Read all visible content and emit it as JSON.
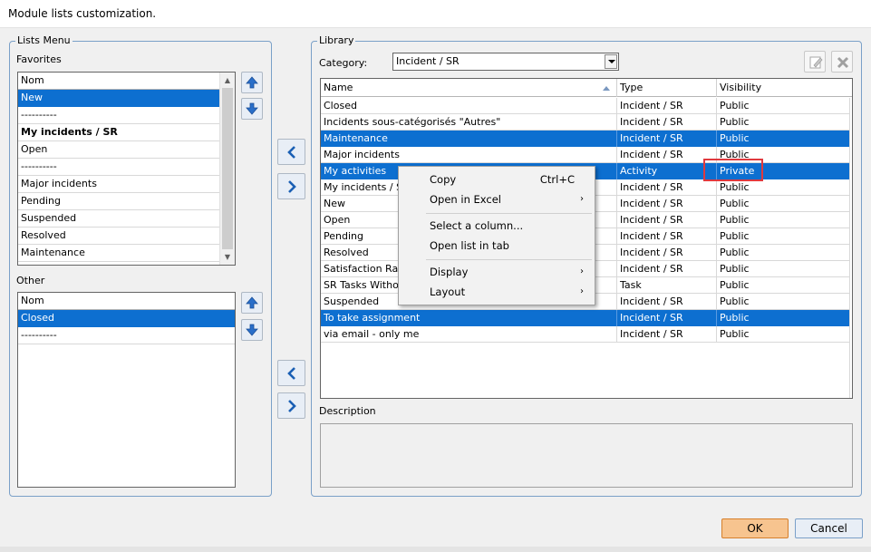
{
  "window": {
    "title": "Module lists customization."
  },
  "lists_menu": {
    "title": "Lists Menu",
    "favorites": {
      "label": "Favorites",
      "header": "Nom",
      "items": [
        {
          "label": "New",
          "selected": true,
          "bold": false
        },
        {
          "label": "----------",
          "selected": false,
          "bold": false
        },
        {
          "label": "My incidents / SR",
          "selected": false,
          "bold": true
        },
        {
          "label": "Open",
          "selected": false,
          "bold": false
        },
        {
          "label": "----------",
          "selected": false,
          "bold": false
        },
        {
          "label": "Major incidents",
          "selected": false,
          "bold": false
        },
        {
          "label": "Pending",
          "selected": false,
          "bold": false
        },
        {
          "label": "Suspended",
          "selected": false,
          "bold": false
        },
        {
          "label": "Resolved",
          "selected": false,
          "bold": false
        },
        {
          "label": "Maintenance",
          "selected": false,
          "bold": false
        }
      ]
    },
    "other": {
      "label": "Other",
      "header": "Nom",
      "items": [
        {
          "label": "Closed",
          "selected": true,
          "bold": false
        },
        {
          "label": "----------",
          "selected": false,
          "bold": false
        }
      ]
    }
  },
  "library": {
    "title": "Library",
    "category_label": "Category:",
    "category_value": "Incident / SR",
    "columns": {
      "name": "Name",
      "type": "Type",
      "visibility": "Visibility"
    },
    "rows": [
      {
        "name": "Closed",
        "type": "Incident / SR",
        "visibility": "Public",
        "selected": false
      },
      {
        "name": "Incidents sous-catégorisés \"Autres\"",
        "type": "Incident / SR",
        "visibility": "Public",
        "selected": false
      },
      {
        "name": "Maintenance",
        "type": "Incident / SR",
        "visibility": "Public",
        "selected": true
      },
      {
        "name": "Major incidents",
        "type": "Incident / SR",
        "visibility": "Public",
        "selected": false
      },
      {
        "name": "My activities",
        "type": "Activity",
        "visibility": "Private",
        "selected": true
      },
      {
        "name": "My incidents / SR",
        "type": "Incident / SR",
        "visibility": "Public",
        "selected": false
      },
      {
        "name": "New",
        "type": "Incident / SR",
        "visibility": "Public",
        "selected": false
      },
      {
        "name": "Open",
        "type": "Incident / SR",
        "visibility": "Public",
        "selected": false
      },
      {
        "name": "Pending",
        "type": "Incident / SR",
        "visibility": "Public",
        "selected": false
      },
      {
        "name": "Resolved",
        "type": "Incident / SR",
        "visibility": "Public",
        "selected": false
      },
      {
        "name": "Satisfaction Rating",
        "type": "Incident / SR",
        "visibility": "Public",
        "selected": false
      },
      {
        "name": "SR Tasks Without",
        "type": "Task",
        "visibility": "Public",
        "selected": false
      },
      {
        "name": "Suspended",
        "type": "Incident / SR",
        "visibility": "Public",
        "selected": false
      },
      {
        "name": "To take assignment",
        "type": "Incident / SR",
        "visibility": "Public",
        "selected": true
      },
      {
        "name": "via email - only me",
        "type": "Incident / SR",
        "visibility": "Public",
        "selected": false
      }
    ],
    "description_label": "Description"
  },
  "context_menu": {
    "items": [
      {
        "label": "Copy",
        "shortcut": "Ctrl+C",
        "submenu": false
      },
      {
        "label": "Open in Excel",
        "shortcut": "",
        "submenu": true
      },
      {
        "label": "Select a column...",
        "shortcut": "",
        "submenu": false
      },
      {
        "label": "Open list in tab",
        "shortcut": "",
        "submenu": false
      },
      {
        "label": "Display",
        "shortcut": "",
        "submenu": true
      },
      {
        "label": "Layout",
        "shortcut": "",
        "submenu": true
      }
    ]
  },
  "buttons": {
    "ok": "OK",
    "cancel": "Cancel"
  },
  "colors": {
    "selection": "#0d6fd0",
    "highlight_box": "#e0393e",
    "ok_button": "#f7c48f"
  }
}
